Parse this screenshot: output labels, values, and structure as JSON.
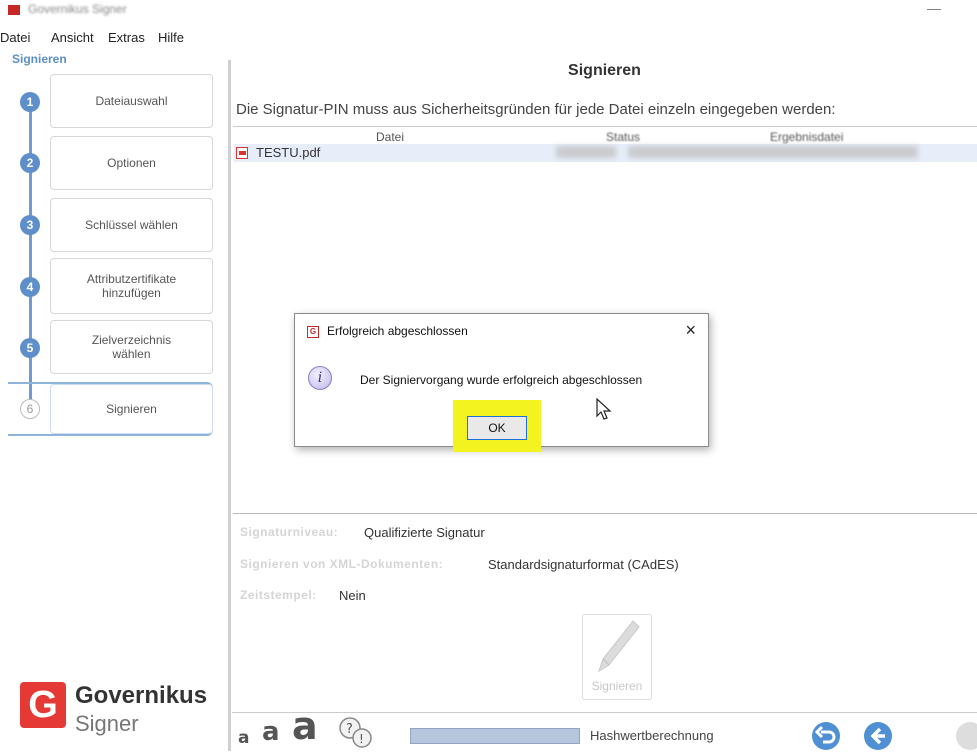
{
  "window": {
    "title": "Governikus Signer",
    "minimize": "—"
  },
  "menu": [
    "Datei",
    "Ansicht",
    "Extras",
    "Hilfe"
  ],
  "sidebar": {
    "title": "Signieren",
    "steps": [
      {
        "number": "1",
        "label": "Dateiauswahl"
      },
      {
        "number": "2",
        "label": "Optionen"
      },
      {
        "number": "3",
        "label": "Schlüssel wählen"
      },
      {
        "number": "4",
        "label": "Attributzertifikate hinzufügen"
      },
      {
        "number": "5",
        "label": "Zielverzeichnis wählen"
      },
      {
        "number": "6",
        "label": "Signieren"
      }
    ]
  },
  "main": {
    "title": "Signieren",
    "instruction": "Die Signatur-PIN muss aus Sicherheitsgründen für jede Datei einzeln eingegeben werden:",
    "table": {
      "columns": [
        "Datei",
        "Status",
        "Ergebnisdatei"
      ],
      "rows": [
        {
          "file": "TESTU.pdf"
        }
      ]
    },
    "info": [
      {
        "label": "Signaturniveau:",
        "value": "Qualifizierte Signatur"
      },
      {
        "label": "Signieren von XML-Dokumenten:",
        "value": "Standardsignaturformat (CAdES)"
      },
      {
        "label": "Zeitstempel:",
        "value": "Nein"
      }
    ],
    "sign_button": "Signieren"
  },
  "logo": {
    "line1": "Governikus",
    "line2": "Signer",
    "mark": "G"
  },
  "bottom": {
    "font_sizes": [
      "a",
      "a",
      "a"
    ],
    "progress_label": "Hashwertberechnung",
    "progress_value": 1.0
  },
  "dialog": {
    "app_icon": "G",
    "title": "Erfolgreich abgeschlossen",
    "close": "×",
    "info_glyph": "i",
    "message": "Der Signiervorgang wurde erfolgreich abgeschlossen",
    "ok_label": "OK",
    "highlight_color": "#f3f320"
  },
  "colors": {
    "accent": "#5f8fcb",
    "brand": "#e53935"
  }
}
